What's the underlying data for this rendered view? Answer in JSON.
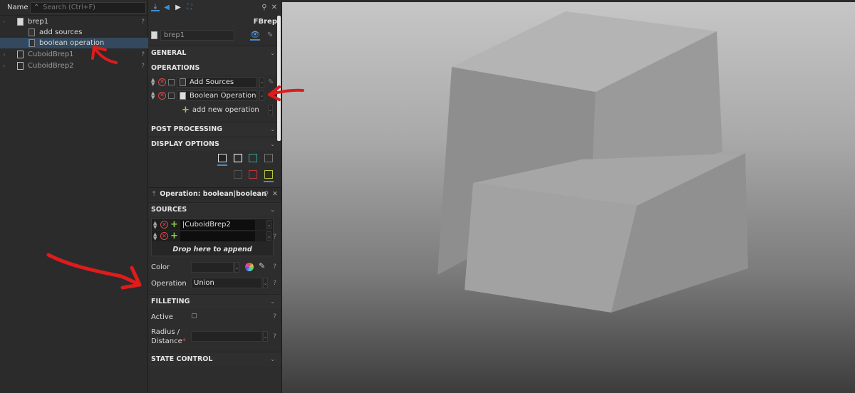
{
  "tree": {
    "header_label": "Name",
    "search_placeholder": "Search (Ctrl+F)",
    "items": [
      {
        "label": "brep1",
        "help": "?"
      },
      {
        "label": "add sources"
      },
      {
        "label": "boolean operation"
      },
      {
        "label": "CuboidBrep1",
        "help": "?"
      },
      {
        "label": "CuboidBrep2",
        "help": "?"
      }
    ]
  },
  "props": {
    "object_type": "FBrep",
    "object_name": "brep1",
    "sections": {
      "general": "GENERAL",
      "operations": "OPERATIONS",
      "post_processing": "POST PROCESSING",
      "display_options": "DISPLAY OPTIONS",
      "sources": "SOURCES",
      "filleting": "FILLETING",
      "state_control": "STATE CONTROL"
    },
    "operations": [
      {
        "label": "Add Sources"
      },
      {
        "label": "Boolean Operation"
      }
    ],
    "add_operation_label": "add new operation",
    "operation_header": "Operation: boolean|boolean",
    "sources": [
      {
        "value": "|CuboidBrep2"
      },
      {
        "value": ""
      }
    ],
    "drop_hint": "Drop here to append",
    "color_label": "Color",
    "operation_label": "Operation",
    "operation_value": "Union",
    "active_label": "Active",
    "radius_label_1": "Radius /",
    "radius_label_2": "Distance",
    "help": "?"
  },
  "colors": {
    "accent": "#3d8fd6",
    "annotation": "#e01b1b",
    "delete": "#e04848",
    "add": "#8fd14f"
  }
}
